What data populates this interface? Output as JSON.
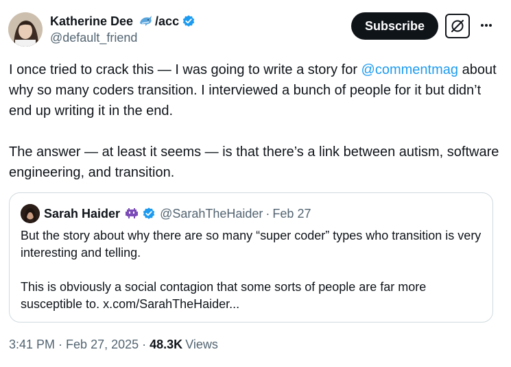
{
  "author": {
    "display_name": "Katherine Dee",
    "name_suffix": "/acc",
    "handle": "@default_friend",
    "emoji": "dolphin-emoji",
    "verified": true
  },
  "actions": {
    "subscribe_label": "Subscribe",
    "grok_icon": "grok-icon",
    "more_icon": "more-icon"
  },
  "tweet": {
    "text_before": "I once tried to crack this — I was going to write a story for ",
    "mention": "@commentmag",
    "text_after": " about why so many coders transition. I interviewed a bunch of people for it but didn’t end up writing it in the end.\n\nThe answer — at least it seems — is that there’s a link between autism, software engineering, and transition."
  },
  "quote": {
    "display_name": "Sarah Haider",
    "emoji": "alien-monster-emoji",
    "verified": true,
    "handle": "@SarahTheHaider",
    "separator": "·",
    "date": "Feb 27",
    "text": "But the story about why there are so many “super coder” types who transition is very interesting and telling.\n\nThis is obviously a social contagion that some sorts of people are far more susceptible to. x.com/SarahTheHaider..."
  },
  "meta": {
    "time": "3:41 PM",
    "separator": "·",
    "date": "Feb 27, 2025",
    "views_count": "48.3K",
    "views_label": "Views"
  },
  "colors": {
    "link": "#1d9bf0",
    "verified": "#1d9bf0",
    "secondary_text": "#536471",
    "primary_text": "#0f1419",
    "border": "#cfd9de"
  }
}
